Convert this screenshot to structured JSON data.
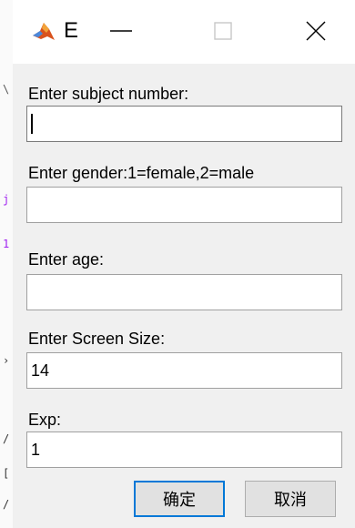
{
  "window": {
    "title": "E",
    "minimize_glyph": "—",
    "maximize_glyph": "□",
    "close_glyph": "✕",
    "app_icon": "matlab-logo-icon"
  },
  "fields": [
    {
      "label": "Enter subject number:",
      "value": ""
    },
    {
      "label": "Enter gender:1=female,2=male",
      "value": ""
    },
    {
      "label": "Enter age:",
      "value": ""
    },
    {
      "label": "Enter Screen Size:",
      "value": "14"
    },
    {
      "label": "Exp:",
      "value": "1"
    }
  ],
  "buttons": {
    "ok_label": "确定",
    "cancel_label": "取消"
  },
  "colors": {
    "dialog_bg": "#f0f0f0",
    "focus_border": "#0078d7",
    "button_bg": "#e1e1e1"
  }
}
